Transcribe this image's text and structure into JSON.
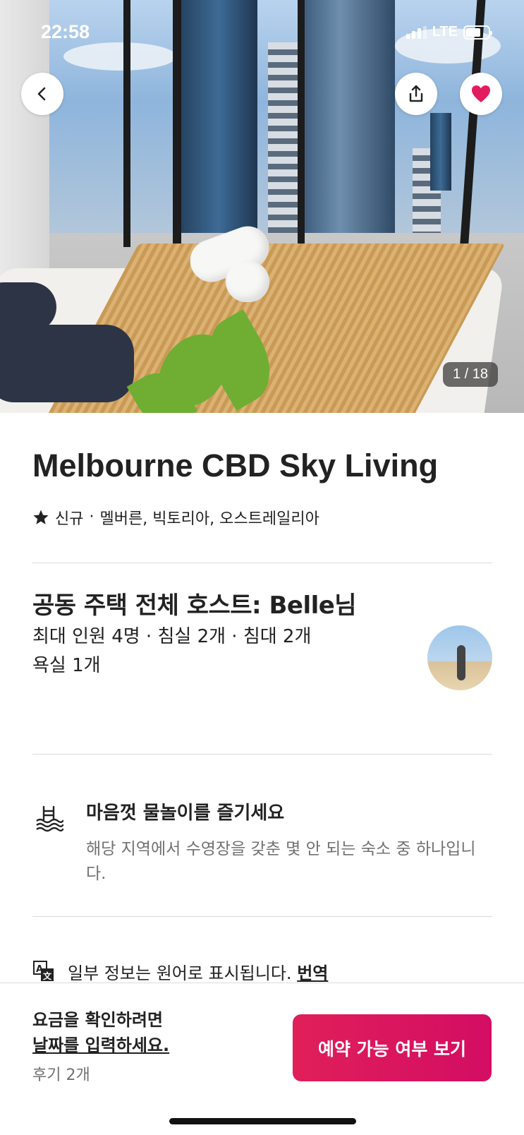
{
  "status_bar": {
    "time": "22:58",
    "network": "LTE",
    "signal_bars": 3,
    "signal_bars_total": 4
  },
  "hero": {
    "photo_counter": "1 / 18"
  },
  "listing": {
    "title": "Melbourne CBD Sky Living",
    "rating_label": "신규",
    "location": "멜버른, 빅토리아, 오스트레일리아"
  },
  "host": {
    "title": "공동 주택 전체 호스트: Belle님",
    "details_line1": "최대 인원 4명 · 침실 2개 · 침대 2개",
    "details_line2": "욕실 1개"
  },
  "feature": {
    "title": "마음껏 물놀이를 즐기세요",
    "description": "해당 지역에서 수영장을 갖춘 몇 안 되는 숙소 중 하나입니다."
  },
  "translation": {
    "text": "일부 정보는 원어로 표시됩니다.",
    "link": "번역"
  },
  "footer": {
    "price_line1": "요금을 확인하려면",
    "price_line2": "날짜를 입력하세요.",
    "reviews": "후기 2개",
    "reserve_button": "예약 가능 여부 보기"
  },
  "colors": {
    "accent": "#e01f5a",
    "favorite_heart": "#e31c5f"
  },
  "icons": [
    "back-arrow-icon",
    "share-icon",
    "heart-icon",
    "star-icon",
    "pool-icon",
    "translate-icon"
  ]
}
